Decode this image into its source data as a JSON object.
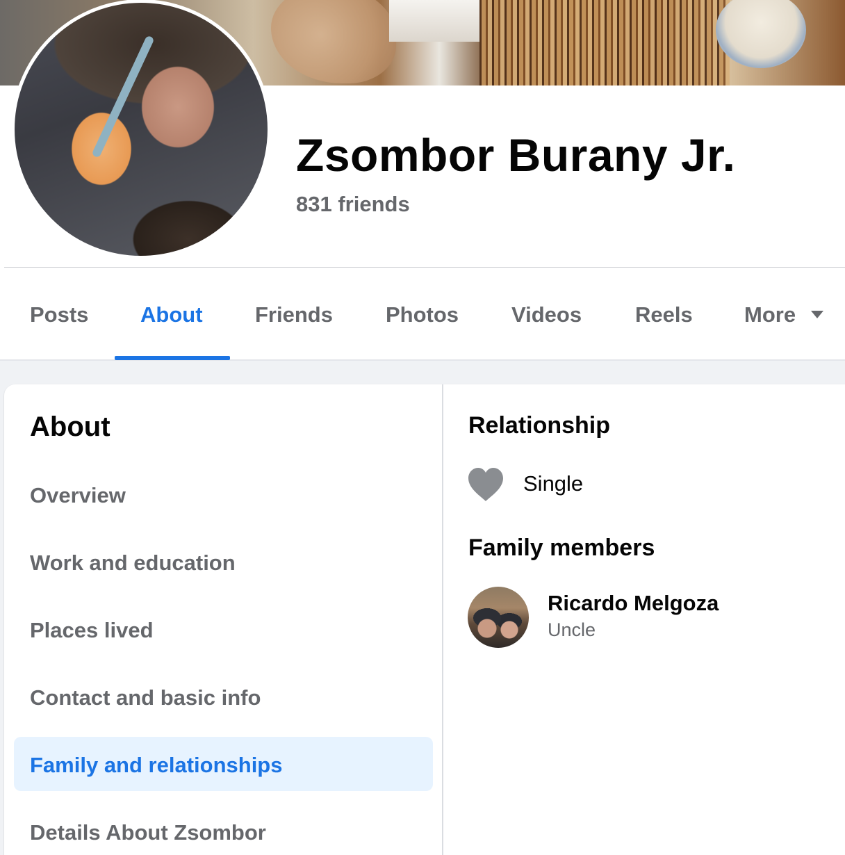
{
  "profile": {
    "name": "Zsombor Burany Jr.",
    "friends_count": "831 friends"
  },
  "tabs": [
    {
      "label": "Posts",
      "active": false
    },
    {
      "label": "About",
      "active": true
    },
    {
      "label": "Friends",
      "active": false
    },
    {
      "label": "Photos",
      "active": false
    },
    {
      "label": "Videos",
      "active": false
    },
    {
      "label": "Reels",
      "active": false
    },
    {
      "label": "More",
      "active": false
    }
  ],
  "about_nav": {
    "title": "About",
    "items": [
      {
        "label": "Overview",
        "active": false
      },
      {
        "label": "Work and education",
        "active": false
      },
      {
        "label": "Places lived",
        "active": false
      },
      {
        "label": "Contact and basic info",
        "active": false
      },
      {
        "label": "Family and relationships",
        "active": true
      },
      {
        "label": "Details About Zsombor",
        "active": false
      }
    ]
  },
  "relationship": {
    "title": "Relationship",
    "status": "Single",
    "icon": "heart-icon"
  },
  "family": {
    "title": "Family members",
    "members": [
      {
        "name": "Ricardo Melgoza",
        "relation": "Uncle"
      }
    ]
  },
  "colors": {
    "accent": "#1b74e4",
    "muted_text": "#65676b",
    "active_bg": "#e7f3ff",
    "page_bg": "#f0f2f5"
  }
}
